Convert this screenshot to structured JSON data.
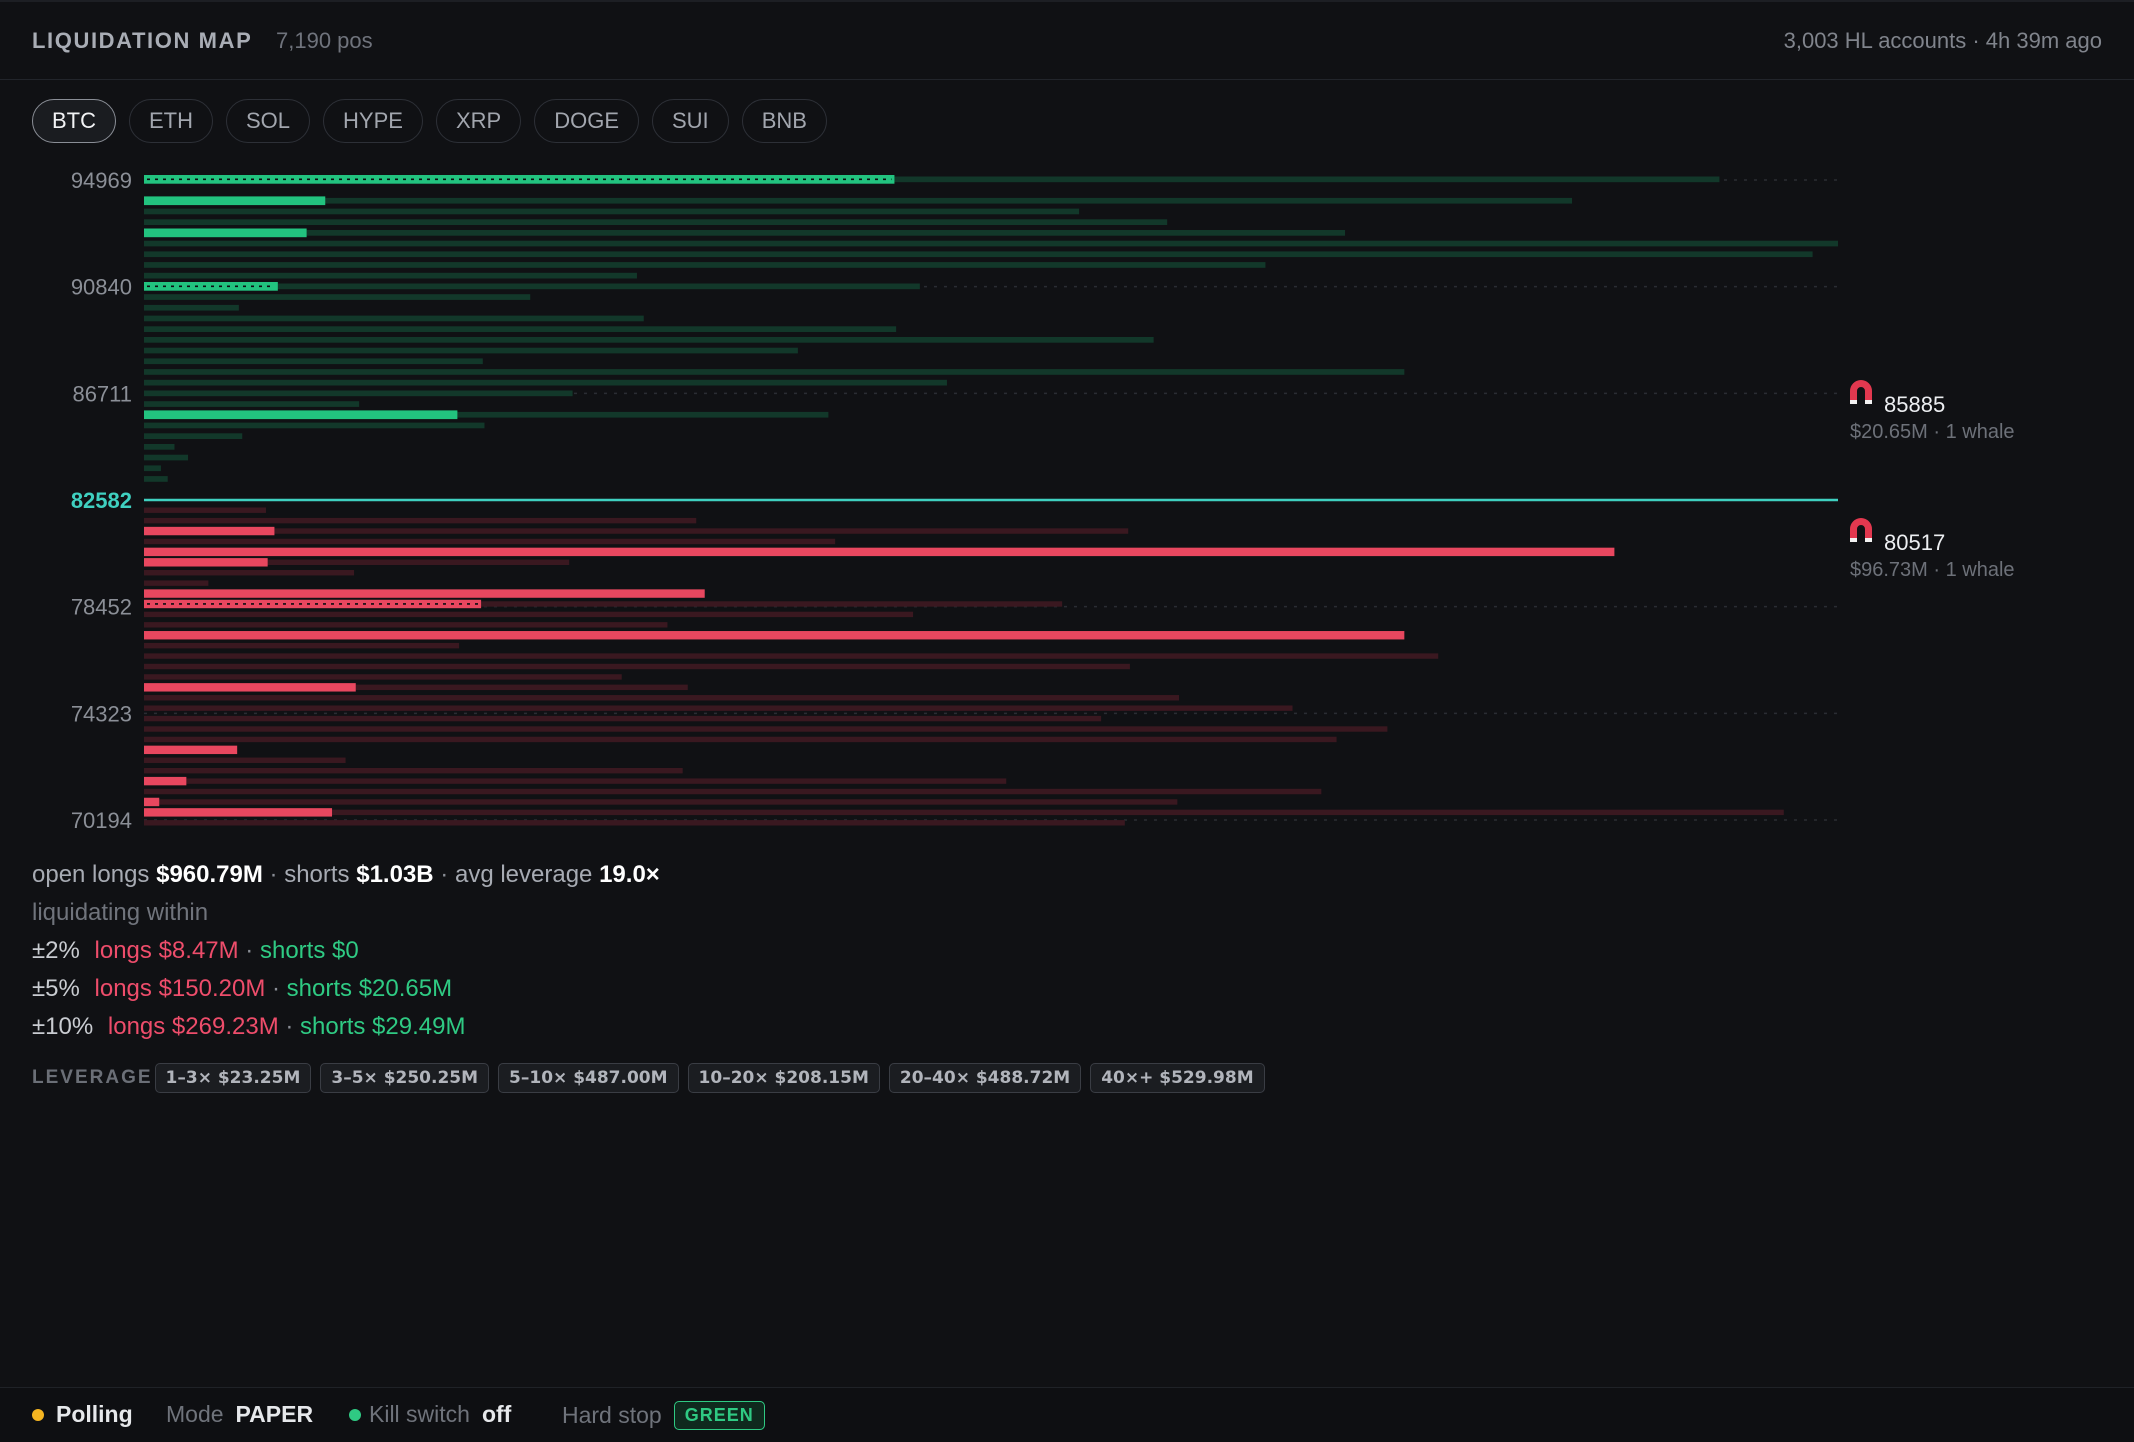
{
  "header": {
    "title": "LIQUIDATION MAP",
    "positions": "7,190 pos",
    "accounts_status": "3,003 HL accounts · 4h 39m ago"
  },
  "tabs": [
    {
      "label": "BTC",
      "active": true
    },
    {
      "label": "ETH",
      "active": false
    },
    {
      "label": "SOL",
      "active": false
    },
    {
      "label": "HYPE",
      "active": false
    },
    {
      "label": "XRP",
      "active": false
    },
    {
      "label": "DOGE",
      "active": false
    },
    {
      "label": "SUI",
      "active": false
    },
    {
      "label": "BNB",
      "active": false
    }
  ],
  "chart_data": {
    "type": "bar",
    "orientation": "horizontal",
    "y_ticks": [
      "94969",
      "90840",
      "86711",
      "82582",
      "78452",
      "74323",
      "70194"
    ],
    "current_price": "82582",
    "ylim": [
      70194,
      94969
    ],
    "colors": {
      "short_bright": "#22c37f",
      "short_dim": "#12382a",
      "long_bright": "#e8475f",
      "long_dim": "#3a1820",
      "current_line": "#3fd0c0"
    },
    "short_rows": [
      {
        "bright": 0.443,
        "dim": 0.487,
        "dotted": true
      },
      {
        "bright": 0.0,
        "dim": 0.0
      },
      {
        "bright": 0.107,
        "dim": 0.736
      },
      {
        "bright": 0.0,
        "dim": 0.552
      },
      {
        "bright": 0.0,
        "dim": 0.604
      },
      {
        "bright": 0.096,
        "dim": 0.613
      },
      {
        "bright": 0.0,
        "dim": 1.0
      },
      {
        "bright": 0.0,
        "dim": 0.985
      },
      {
        "bright": 0.0,
        "dim": 0.662
      },
      {
        "bright": 0.0,
        "dim": 0.291
      },
      {
        "bright": 0.079,
        "dim": 0.379,
        "dotted": true
      },
      {
        "bright": 0.0,
        "dim": 0.228
      },
      {
        "bright": 0.0,
        "dim": 0.056
      },
      {
        "bright": 0.0,
        "dim": 0.295
      },
      {
        "bright": 0.0,
        "dim": 0.444
      },
      {
        "bright": 0.0,
        "dim": 0.596
      },
      {
        "bright": 0.0,
        "dim": 0.386
      },
      {
        "bright": 0.0,
        "dim": 0.2
      },
      {
        "bright": 0.0,
        "dim": 0.744
      },
      {
        "bright": 0.0,
        "dim": 0.474
      },
      {
        "bright": 0.0,
        "dim": 0.253
      },
      {
        "bright": 0.0,
        "dim": 0.127
      },
      {
        "bright": 0.185,
        "dim": 0.219
      },
      {
        "bright": 0.0,
        "dim": 0.201
      },
      {
        "bright": 0.0,
        "dim": 0.058
      },
      {
        "bright": 0.0,
        "dim": 0.018
      },
      {
        "bright": 0.0,
        "dim": 0.026
      },
      {
        "bright": 0.0,
        "dim": 0.01
      },
      {
        "bright": 0.0,
        "dim": 0.014
      },
      {
        "bright": 0.0,
        "dim": 0.0
      }
    ],
    "long_rows": [
      {
        "bright": 0.0,
        "dim": 0.072
      },
      {
        "bright": 0.0,
        "dim": 0.326
      },
      {
        "bright": 0.077,
        "dim": 0.504
      },
      {
        "bright": 0.0,
        "dim": 0.408
      },
      {
        "bright": 0.868,
        "dim": 0.0
      },
      {
        "bright": 0.073,
        "dim": 0.178
      },
      {
        "bright": 0.0,
        "dim": 0.124
      },
      {
        "bright": 0.0,
        "dim": 0.038
      },
      {
        "bright": 0.331,
        "dim": 0.0
      },
      {
        "bright": 0.199,
        "dim": 0.343,
        "dotted": true
      },
      {
        "bright": 0.0,
        "dim": 0.454
      },
      {
        "bright": 0.0,
        "dim": 0.309
      },
      {
        "bright": 0.744,
        "dim": 0.0
      },
      {
        "bright": 0.0,
        "dim": 0.186
      },
      {
        "bright": 0.0,
        "dim": 0.764
      },
      {
        "bright": 0.0,
        "dim": 0.582
      },
      {
        "bright": 0.0,
        "dim": 0.282
      },
      {
        "bright": 0.125,
        "dim": 0.196
      },
      {
        "bright": 0.0,
        "dim": 0.611
      },
      {
        "bright": 0.0,
        "dim": 0.678
      },
      {
        "bright": 0.0,
        "dim": 0.565
      },
      {
        "bright": 0.0,
        "dim": 0.734
      },
      {
        "bright": 0.0,
        "dim": 0.704
      },
      {
        "bright": 0.055,
        "dim": 0.0
      },
      {
        "bright": 0.0,
        "dim": 0.119
      },
      {
        "bright": 0.0,
        "dim": 0.318
      },
      {
        "bright": 0.025,
        "dim": 0.484
      },
      {
        "bright": 0.0,
        "dim": 0.695
      },
      {
        "bright": 0.009,
        "dim": 0.601
      },
      {
        "bright": 0.111,
        "dim": 0.857
      },
      {
        "bright": 0.0,
        "dim": 0.579
      }
    ],
    "magnets": [
      {
        "price": "85885",
        "detail": "$20.65M · 1 whale"
      },
      {
        "price": "80517",
        "detail": "$96.73M · 1 whale"
      }
    ]
  },
  "summary": {
    "open_longs_label": "open longs",
    "open_longs": "$960.79M",
    "shorts_label": "shorts",
    "shorts": "$1.03B",
    "avg_leverage_label": "avg leverage",
    "avg_leverage": "19.0×",
    "liquidating_within": "liquidating within",
    "ranges": [
      {
        "pct": "±2%",
        "longs": "longs $8.47M",
        "shorts": "shorts $0"
      },
      {
        "pct": "±5%",
        "longs": "longs $150.20M",
        "shorts": "shorts $20.65M"
      },
      {
        "pct": "±10%",
        "longs": "longs $269.23M",
        "shorts": "shorts $29.49M"
      }
    ]
  },
  "leverage": {
    "label": "LEVERAGE",
    "buckets": [
      "1–3× $23.25M",
      "3–5× $250.25M",
      "5–10× $487.00M",
      "10–20× $208.15M",
      "20–40× $488.72M",
      "40×+ $529.98M"
    ]
  },
  "footer": {
    "status": "Polling",
    "status_color": "#f5b521",
    "mode_label": "Mode",
    "mode": "PAPER",
    "kill_switch_label": "Kill switch",
    "kill_switch": "off",
    "kill_switch_color": "#2fca83",
    "hard_stop_label": "Hard stop",
    "hard_stop": "GREEN"
  }
}
